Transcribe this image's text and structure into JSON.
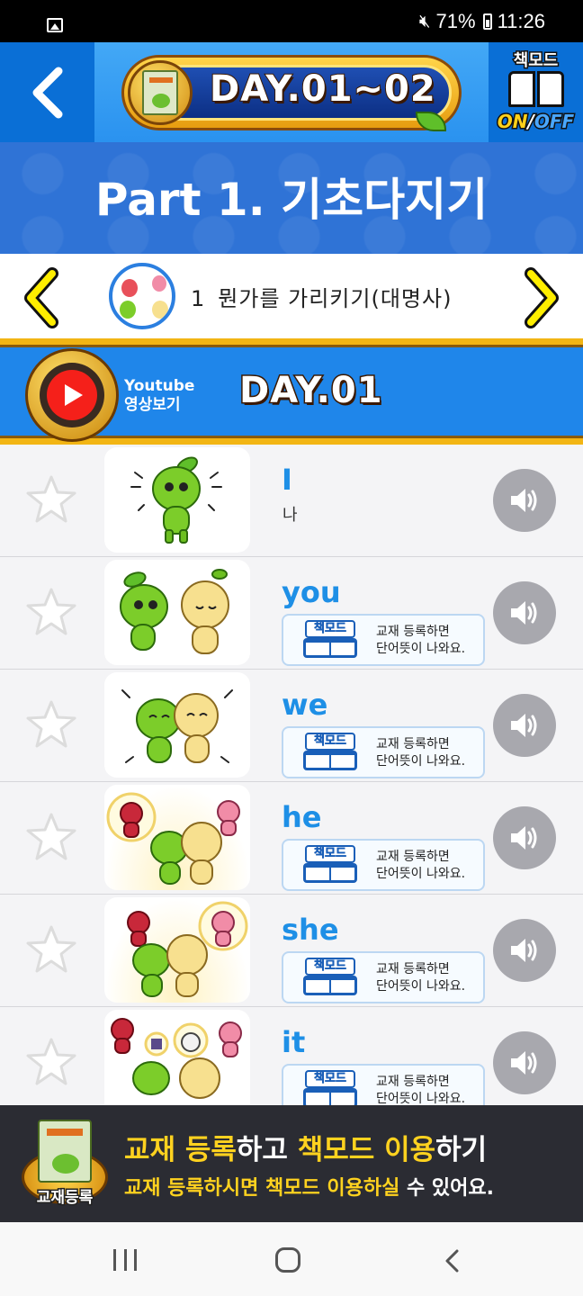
{
  "status_bar": {
    "battery": "71%",
    "time": "11:26"
  },
  "header": {
    "title": "DAY.01~02",
    "bookmode_label": "책모드",
    "bookmode_on": "ON",
    "bookmode_sep": "/",
    "bookmode_off": "OFF"
  },
  "part_title": "Part 1. 기초다지기",
  "lesson": {
    "number": "1",
    "title": "뭔가를 가리키기(대명사)"
  },
  "day_bar": {
    "youtube_line1": "Youtube",
    "youtube_line2": "영상보기",
    "day_title": "DAY.01"
  },
  "lock_notice": {
    "badge": "책모드",
    "line1": "교재 등록하면",
    "line2": "단어뜻이 나와요."
  },
  "words": [
    {
      "word": "I",
      "meaning": "나"
    },
    {
      "word": "you"
    },
    {
      "word": "we"
    },
    {
      "word": "he"
    },
    {
      "word": "she"
    },
    {
      "word": "it"
    }
  ],
  "promo": {
    "icon_label": "교재등록",
    "title_1": "교재 등록",
    "title_2": "하고 ",
    "title_3": "책모드 이용",
    "title_4": "하기",
    "sub_1": "교재 등록하시면 책모드 이용하실",
    "sub_2": " 수 있어요."
  },
  "colors": {
    "accent_blue": "#1f8ff0",
    "word_blue": "#1e8fe6",
    "gold": "#f2b514",
    "highlight_yellow": "#ffd21f"
  }
}
